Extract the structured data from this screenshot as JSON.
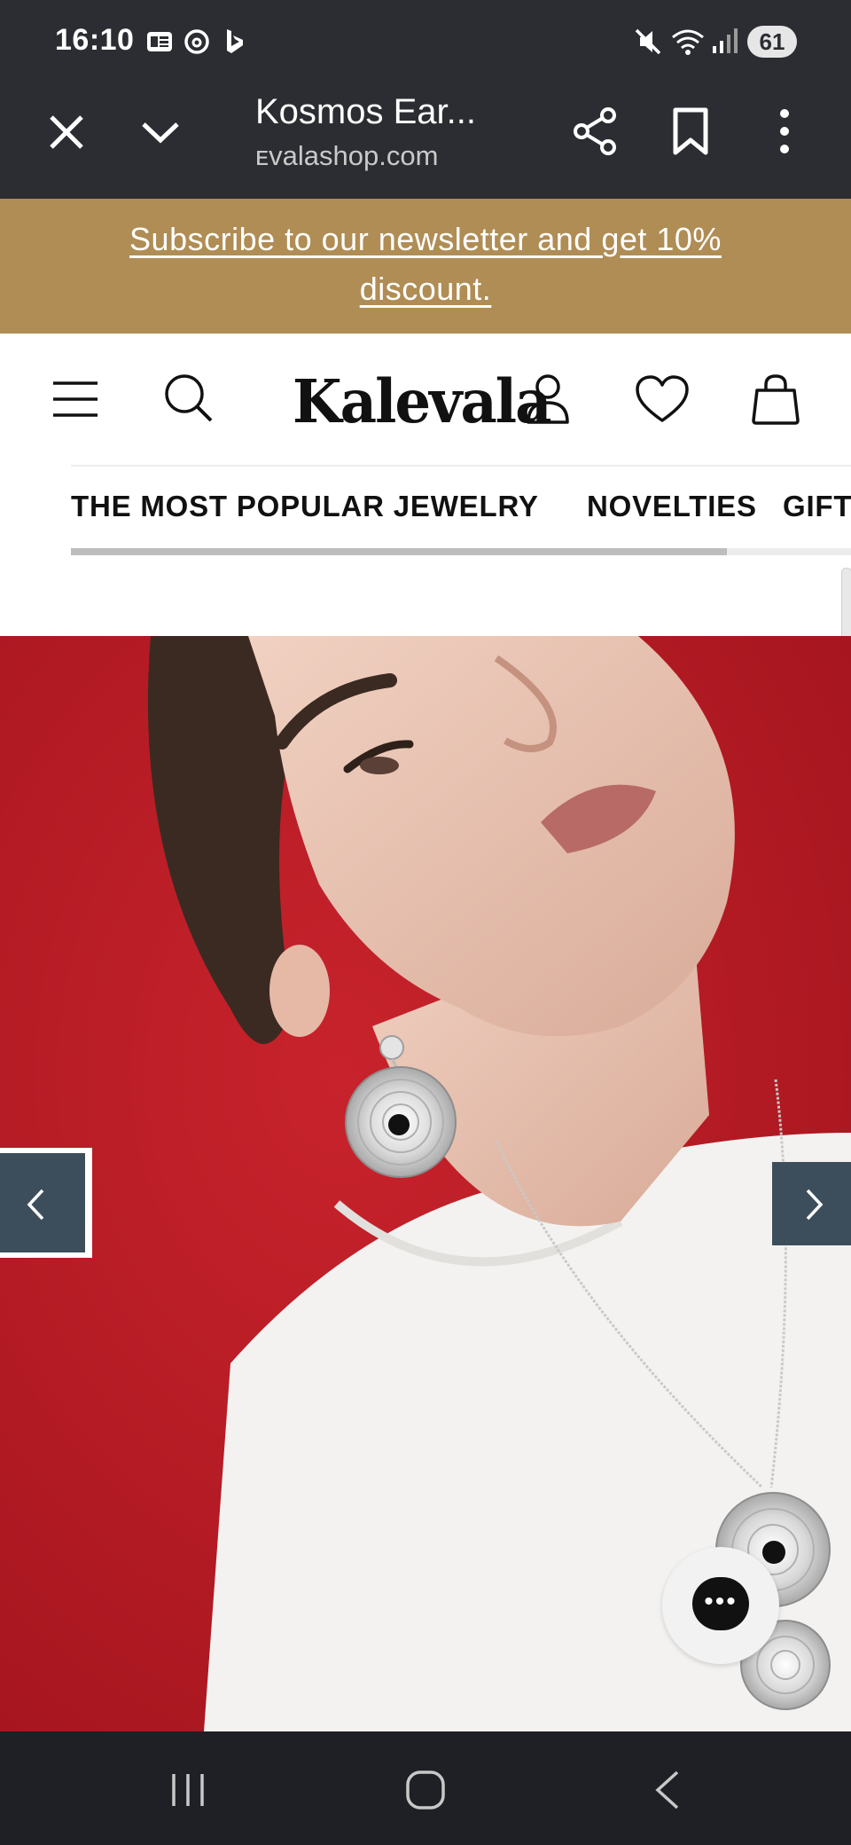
{
  "status_bar": {
    "time": "16:10",
    "left_icons": [
      "news-icon",
      "threads-icon",
      "bing-icon"
    ],
    "right_icons": [
      "mute-icon",
      "wifi-icon",
      "signal-icon"
    ],
    "battery": "61"
  },
  "browser": {
    "title": "Kosmos Ear...",
    "domain": "ᴇvalashop.com",
    "icons": [
      "close-icon",
      "chevron-down-icon",
      "share-icon",
      "bookmark-icon",
      "more-vert-icon"
    ]
  },
  "banner": {
    "text": "Subscribe to our newsletter and get 10% discount.",
    "bg_color": "#b08d55"
  },
  "header": {
    "logo_text": "Kalevala",
    "icons": [
      "menu-icon",
      "search-icon",
      "account-icon",
      "wishlist-icon",
      "cart-icon"
    ]
  },
  "nav": {
    "items": [
      "THE MOST POPULAR JEWELRY",
      "NOVELTIES",
      "GIFT"
    ]
  },
  "hero": {
    "background_color": "#b51c25",
    "prev_icon": "chevron-left-icon",
    "next_icon": "chevron-right-icon",
    "control_color": "#3c4e5c"
  },
  "chat": {
    "icon": "chat-icon"
  },
  "system_nav": {
    "icons": [
      "recents-icon",
      "home-icon",
      "back-icon"
    ]
  }
}
